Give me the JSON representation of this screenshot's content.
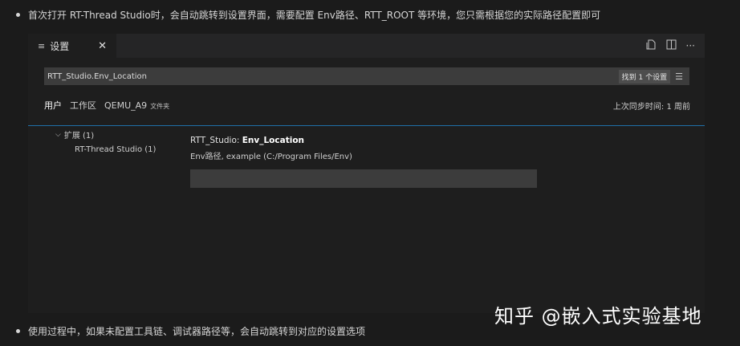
{
  "bullets": {
    "intro": "首次打开 RT-Thread Studio时，会自动跳转到设置界面，需要配置 Env路径、RTT_ROOT 等环境，您只需根据您的实际路径配置即可",
    "outro": "使用过程中，如果未配置工具链、调试器路径等，会自动跳转到对应的设置选项"
  },
  "tab": {
    "icon": "list-icon",
    "label": "设置",
    "close_icon": "close-icon"
  },
  "editor_actions": [
    "open-json-icon",
    "split-editor-icon",
    "more-icon"
  ],
  "search": {
    "value": "RTT_Studio.Env_Location",
    "result_count": "找到 1 个设置",
    "clear_icon": "clear-filter-icon"
  },
  "scopes": [
    {
      "label": "用户",
      "suffix": "",
      "active": true
    },
    {
      "label": "工作区",
      "suffix": "",
      "active": false
    },
    {
      "label": "QEMU_A9",
      "suffix": "文件夹",
      "active": false
    }
  ],
  "sync_status": "上次同步时间: 1 周前",
  "toc": {
    "group_label": "扩展 (1)",
    "item_label": "RT-Thread Studio (1)"
  },
  "setting": {
    "prefix": "RTT_Studio: ",
    "name": "Env_Location",
    "description": "Env路径, example (C:/Program Files/Env)",
    "value": ""
  },
  "watermark": "知乎 @嵌入式实验基地"
}
